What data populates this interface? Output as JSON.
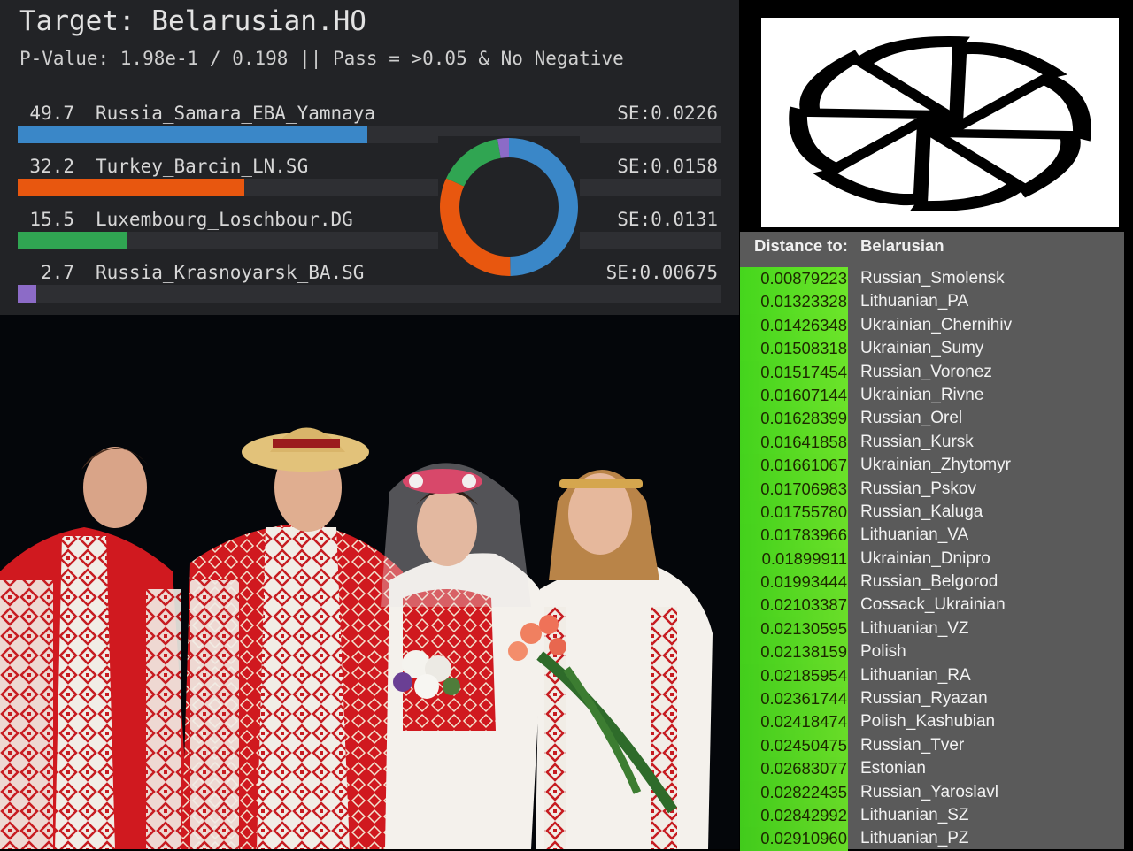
{
  "qpadm": {
    "title": "Target: Belarusian.HO",
    "subtitle": "P-Value: 1.98e-1 / 0.198 || Pass = >0.05 & No Negative",
    "stamp": "",
    "sources": [
      {
        "pct": "49.7",
        "value": 49.7,
        "population": "Russia_Samara_EBA_Yamnaya",
        "se": "SE:0.0226",
        "color": "#3a87c8"
      },
      {
        "pct": "32.2",
        "value": 32.2,
        "population": "Turkey_Barcin_LN.SG",
        "se": "SE:0.0158",
        "color": "#e8570f"
      },
      {
        "pct": "15.5",
        "value": 15.5,
        "population": "Luxembourg_Loschbour.DG",
        "se": "SE:0.0131",
        "color": "#30a552"
      },
      {
        "pct": "2.7",
        "value": 2.7,
        "population": "Russia_Krasnoyarsk_BA.SG",
        "se": "SE:0.00675",
        "color": "#8c6bc7"
      }
    ]
  },
  "distance": {
    "label": "Distance to:",
    "target": "Belarusian",
    "value_color": "#6de52a",
    "rows": [
      {
        "value": "0.00879223",
        "name": "Russian_Smolensk"
      },
      {
        "value": "0.01323328",
        "name": "Lithuanian_PA"
      },
      {
        "value": "0.01426348",
        "name": "Ukrainian_Chernihiv"
      },
      {
        "value": "0.01508318",
        "name": "Ukrainian_Sumy"
      },
      {
        "value": "0.01517454",
        "name": "Russian_Voronez"
      },
      {
        "value": "0.01607144",
        "name": "Ukrainian_Rivne"
      },
      {
        "value": "0.01628399",
        "name": "Russian_Orel"
      },
      {
        "value": "0.01641858",
        "name": "Russian_Kursk"
      },
      {
        "value": "0.01661067",
        "name": "Ukrainian_Zhytomyr"
      },
      {
        "value": "0.01706983",
        "name": "Russian_Pskov"
      },
      {
        "value": "0.01755780",
        "name": "Russian_Kaluga"
      },
      {
        "value": "0.01783966",
        "name": "Lithuanian_VA"
      },
      {
        "value": "0.01899911",
        "name": "Ukrainian_Dnipro"
      },
      {
        "value": "0.01993444",
        "name": "Russian_Belgorod"
      },
      {
        "value": "0.02103387",
        "name": "Cossack_Ukrainian"
      },
      {
        "value": "0.02130595",
        "name": "Lithuanian_VZ"
      },
      {
        "value": "0.02138159",
        "name": "Polish"
      },
      {
        "value": "0.02185954",
        "name": "Lithuanian_RA"
      },
      {
        "value": "0.02361744",
        "name": "Russian_Ryazan"
      },
      {
        "value": "0.02418474",
        "name": "Polish_Kashubian"
      },
      {
        "value": "0.02450475",
        "name": "Russian_Tver"
      },
      {
        "value": "0.02683077",
        "name": "Estonian"
      },
      {
        "value": "0.02822435",
        "name": "Russian_Yaroslavl"
      },
      {
        "value": "0.02842992",
        "name": "Lithuanian_SZ"
      },
      {
        "value": "0.02910960",
        "name": "Lithuanian_PZ"
      }
    ]
  },
  "symbol": {
    "icon": "kolovrat-sun-symbol-icon"
  },
  "photo": {
    "icon": "folk-costume-wedding-photo"
  }
}
